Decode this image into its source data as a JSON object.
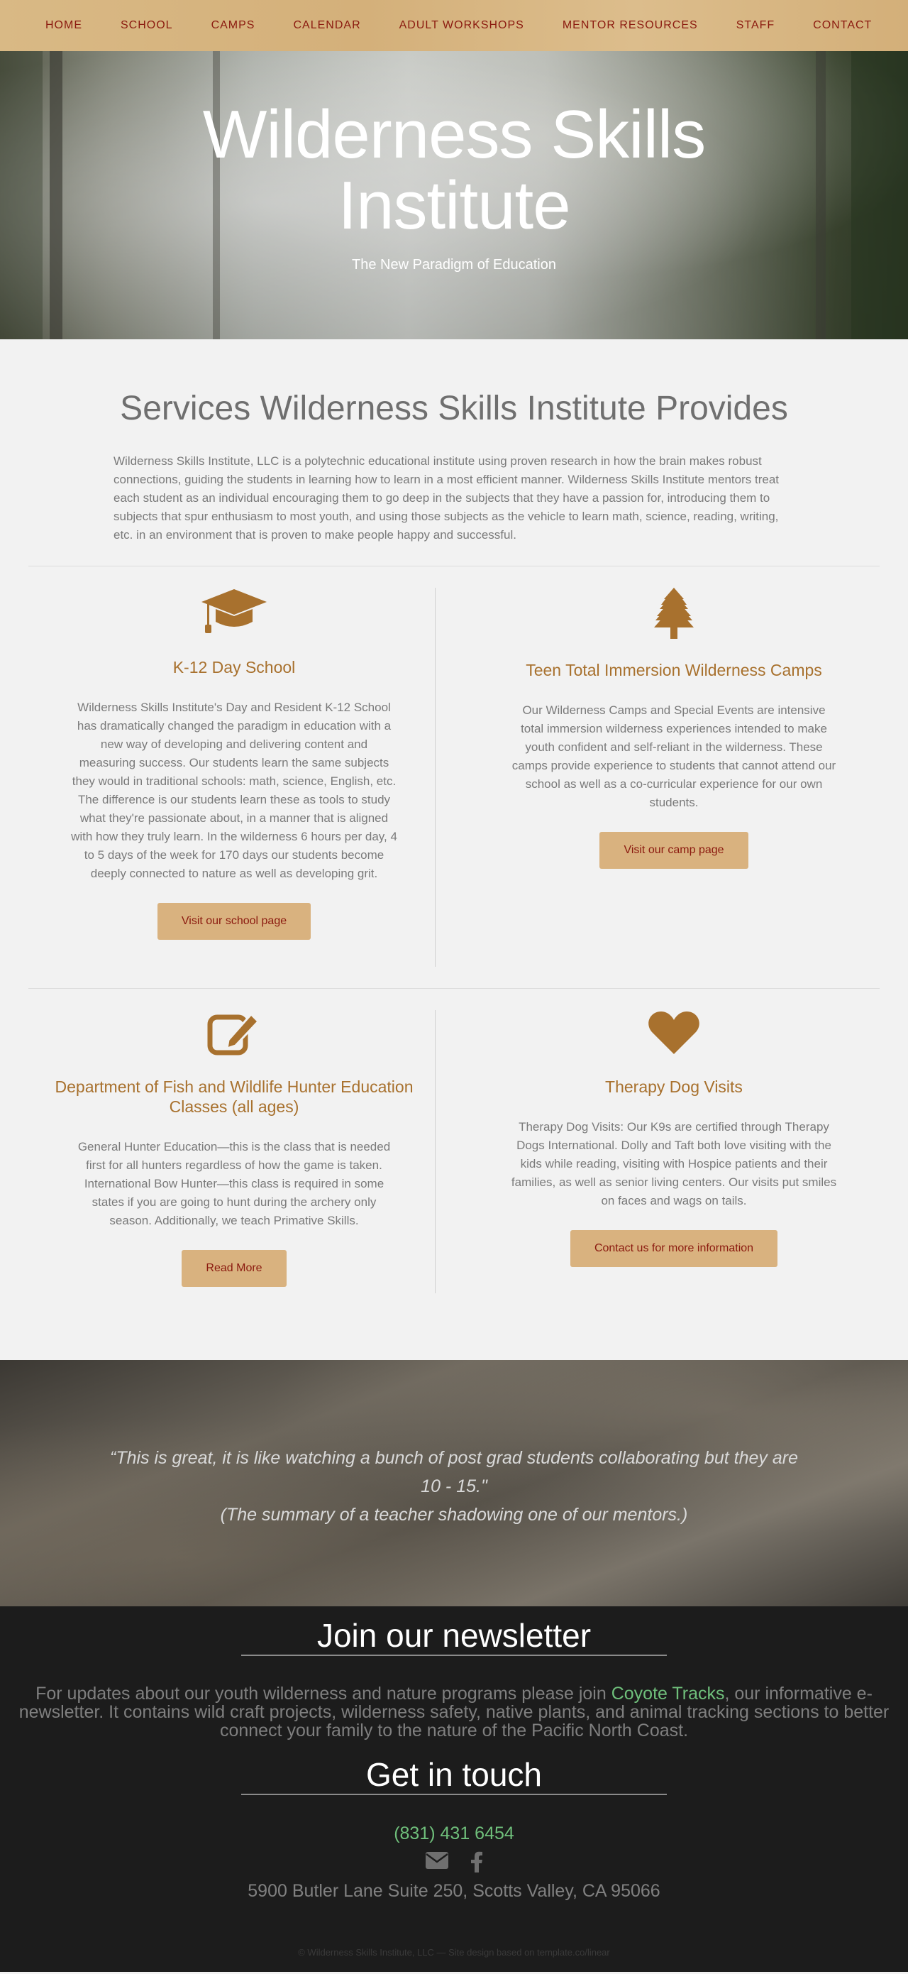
{
  "nav": {
    "items": [
      "HOME",
      "SCHOOL",
      "CAMPS",
      "CALENDAR",
      "ADULT WORKSHOPS",
      "MENTOR RESOURCES",
      "STAFF",
      "CONTACT"
    ]
  },
  "hero": {
    "title_line1": "Wilderness Skills",
    "title_line2": "Institute",
    "subtitle": "The New Paradigm of Education"
  },
  "services": {
    "title": "Services Wilderness Skills Institute Provides",
    "intro": "Wilderness Skills Institute, LLC is a polytechnic educational institute using proven research in how the brain makes robust connections, guiding the students in learning how to learn in a most efficient manner. Wilderness Skills Institute mentors treat each student as an individual encouraging them to go deep in the subjects that they have a passion for, introducing them to subjects that spur enthusiasm to most youth, and using those subjects as the vehicle to learn math, science, reading, writing, etc. in an environment that is proven to make people happy and successful.",
    "cards": [
      {
        "icon": "graduation-cap-icon",
        "title": "K-12 Day School",
        "text": "Wilderness Skills Institute's Day and Resident K-12 School has dramatically changed the paradigm in education with a new way of developing and delivering content and measuring success. Our students learn the same subjects they would in traditional schools: math, science, English, etc. The difference is our students learn these as tools to study what they're passionate about, in a manner that is aligned with how they truly learn. In the wilderness 6 hours per day, 4 to 5 days of the week for 170 days our students become deeply connected to nature as well as developing grit.",
        "button": "Visit our school page"
      },
      {
        "icon": "tree-icon",
        "title": "Teen Total Immersion Wilderness Camps",
        "text": "Our Wilderness Camps and Special Events are intensive total immersion wilderness experiences intended to make youth confident and self-reliant in the wilderness. These camps provide experience to students that cannot attend our school as well as a co-curricular experience for our own students.",
        "button": "Visit our camp page"
      },
      {
        "icon": "edit-icon",
        "title": "Department of Fish and Wildlife Hunter Education Classes (all ages)",
        "text": "General Hunter Education—this is the class that is needed first for all hunters regardless of how the game is taken. International Bow Hunter—this class is required in some states if you are going to hunt during the archery only season. Additionally, we teach Primative Skills.",
        "button": "Read More"
      },
      {
        "icon": "heart-icon",
        "title": "Therapy Dog Visits",
        "text": "Therapy Dog Visits: Our K9s are certified through Therapy Dogs International. Dolly and Taft both love visiting with the kids while reading, visiting with Hospice patients and their families, as well as senior living centers. Our visits put smiles on faces and wags on tails.",
        "button": "Contact us for more information"
      }
    ]
  },
  "quote": {
    "line1": "“This is great, it is like watching a bunch of post grad students collaborating but they are 10 - 15.\"",
    "line2": "(The summary of a teacher shadowing one of our mentors.)"
  },
  "newsletter": {
    "title": "Join our newsletter",
    "text_before": "For updates about our youth wilderness and nature programs please join ",
    "link": "Coyote Tracks",
    "text_after": ", our informative e-newsletter. It contains wild craft projects, wilderness safety, native plants, and animal tracking sections to better connect your family to the nature of the Pacific North Coast."
  },
  "contact": {
    "title": "Get in touch",
    "phone": "(831) 431 6454",
    "social": [
      "envelope-icon",
      "facebook-icon"
    ],
    "address": "5900 Butler Lane Suite 250, Scotts Valley, CA 95066",
    "copyright": "© Wilderness Skills Institute, LLC — Site design based on template.co/linear"
  },
  "colors": {
    "nav_bg": "#d4b07a",
    "nav_text": "#8b1a0f",
    "accent": "#a8712e",
    "button_bg": "#d9b27f",
    "footer_bg": "#1c1c1c",
    "link_green": "#6fbf7b"
  }
}
